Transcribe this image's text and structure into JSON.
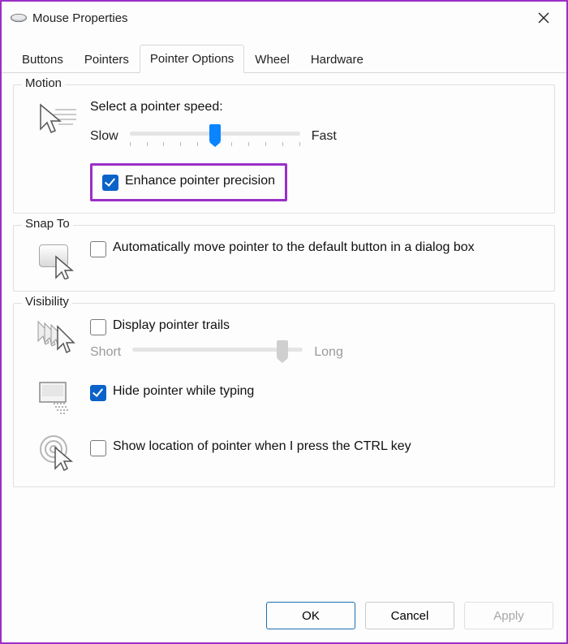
{
  "window": {
    "title": "Mouse Properties"
  },
  "tabs": {
    "buttons": "Buttons",
    "pointers": "Pointers",
    "pointer_options": "Pointer Options",
    "wheel": "Wheel",
    "hardware": "Hardware",
    "active": "pointer_options"
  },
  "motion": {
    "group_label": "Motion",
    "speed_label": "Select a pointer speed:",
    "slow": "Slow",
    "fast": "Fast",
    "speed_value_percent": 50,
    "enhance_label": "Enhance pointer precision",
    "enhance_checked": true
  },
  "snap": {
    "group_label": "Snap To",
    "auto_label": "Automatically move pointer to the default button in a dialog box",
    "auto_checked": false
  },
  "visibility": {
    "group_label": "Visibility",
    "trails_label": "Display pointer trails",
    "trails_checked": false,
    "trails_short": "Short",
    "trails_long": "Long",
    "trails_value_percent": 88,
    "hide_label": "Hide pointer while typing",
    "hide_checked": true,
    "ctrl_label": "Show location of pointer when I press the CTRL key",
    "ctrl_checked": false
  },
  "buttons_bar": {
    "ok": "OK",
    "cancel": "Cancel",
    "apply": "Apply"
  }
}
